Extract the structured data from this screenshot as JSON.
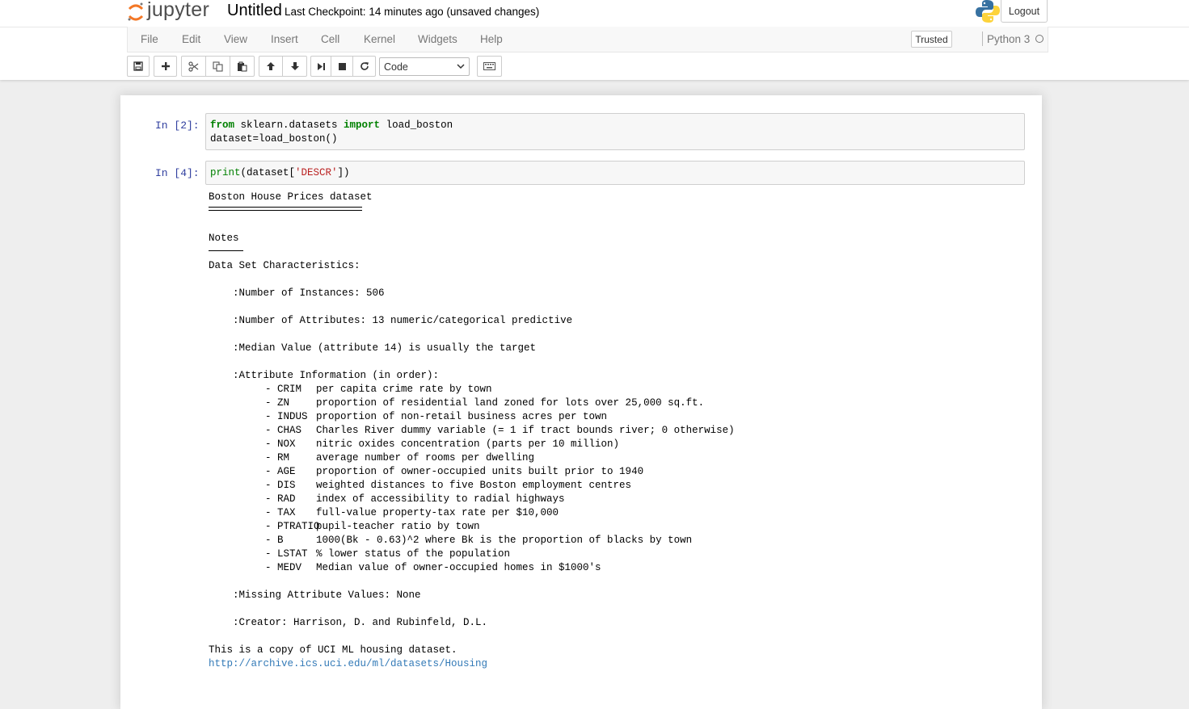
{
  "header": {
    "logo_text": "jupyter",
    "notebook_title": "Untitled",
    "checkpoint_label": "Last Checkpoint:",
    "checkpoint_value": "14 minutes ago",
    "unsaved": "(unsaved changes)",
    "logout_label": "Logout"
  },
  "menu": {
    "items": [
      "File",
      "Edit",
      "View",
      "Insert",
      "Cell",
      "Kernel",
      "Widgets",
      "Help"
    ],
    "trusted_label": "Trusted",
    "kernel_name": "Python 3"
  },
  "toolbar": {
    "buttons": [
      "save-icon",
      "plus-icon",
      "cut-icon",
      "copy-icon",
      "paste-icon",
      "arrow-up-icon",
      "arrow-down-icon",
      "step-forward-icon",
      "stop-icon",
      "refresh-icon",
      "keyboard-icon"
    ],
    "cell_type": "Code"
  },
  "cells": [
    {
      "prompt": "In  [2]:",
      "lines": [
        {
          "parts": [
            {
              "t": "from",
              "c": "kw"
            },
            {
              "t": " sklearn.datasets ",
              "c": ""
            },
            {
              "t": "import",
              "c": "kw"
            },
            {
              "t": " load_boston",
              "c": ""
            }
          ]
        },
        {
          "parts": [
            {
              "t": "dataset=load_boston()",
              "c": ""
            }
          ]
        }
      ]
    },
    {
      "prompt": "In  [4]:",
      "lines": [
        {
          "parts": [
            {
              "t": "print",
              "c": "bi"
            },
            {
              "t": "(dataset[",
              "c": ""
            },
            {
              "t": "'DESCR'",
              "c": "str"
            },
            {
              "t": "])",
              "c": ""
            }
          ]
        }
      ]
    }
  ],
  "output": {
    "title": "Boston House Prices dataset",
    "notes": "Notes",
    "characteristics": "Data Set Characteristics:",
    "instances": ":Number of Instances: 506",
    "attributes": ":Number of Attributes: 13 numeric/categorical predictive",
    "median": ":Median Value (attribute 14) is usually the target",
    "attr_info": ":Attribute Information (in order):",
    "attribute_list": [
      {
        "name": "- CRIM",
        "desc": "per capita crime rate by town"
      },
      {
        "name": "- ZN",
        "desc": "proportion of residential land zoned for lots over 25,000 sq.ft."
      },
      {
        "name": "- INDUS",
        "desc": "proportion of non-retail business acres per town"
      },
      {
        "name": "- CHAS",
        "desc": "Charles River dummy variable (= 1 if tract bounds river; 0 otherwise)"
      },
      {
        "name": "- NOX",
        "desc": "nitric oxides concentration (parts per 10 million)"
      },
      {
        "name": "- RM",
        "desc": "average number of rooms per dwelling"
      },
      {
        "name": "- AGE",
        "desc": "proportion of owner-occupied units built prior to 1940"
      },
      {
        "name": "- DIS",
        "desc": "weighted distances to five Boston employment centres"
      },
      {
        "name": "- RAD",
        "desc": "index of accessibility to radial highways"
      },
      {
        "name": "- TAX",
        "desc": "full-value property-tax rate per $10,000"
      },
      {
        "name": "- PTRATIO",
        "desc": "pupil-teacher ratio by town"
      },
      {
        "name": "- B",
        "desc": "1000(Bk - 0.63)^2 where Bk is the proportion of blacks by town"
      },
      {
        "name": "- LSTAT",
        "desc": "% lower status of the population"
      },
      {
        "name": "- MEDV",
        "desc": "Median value of owner-occupied homes in $1000's"
      }
    ],
    "missing": ":Missing Attribute Values: None",
    "creator": ":Creator: Harrison, D. and Rubinfeld, D.L.",
    "copy_note": "This is a copy of UCI ML housing dataset.",
    "url": "http://archive.ics.uci.edu/ml/datasets/Housing"
  }
}
